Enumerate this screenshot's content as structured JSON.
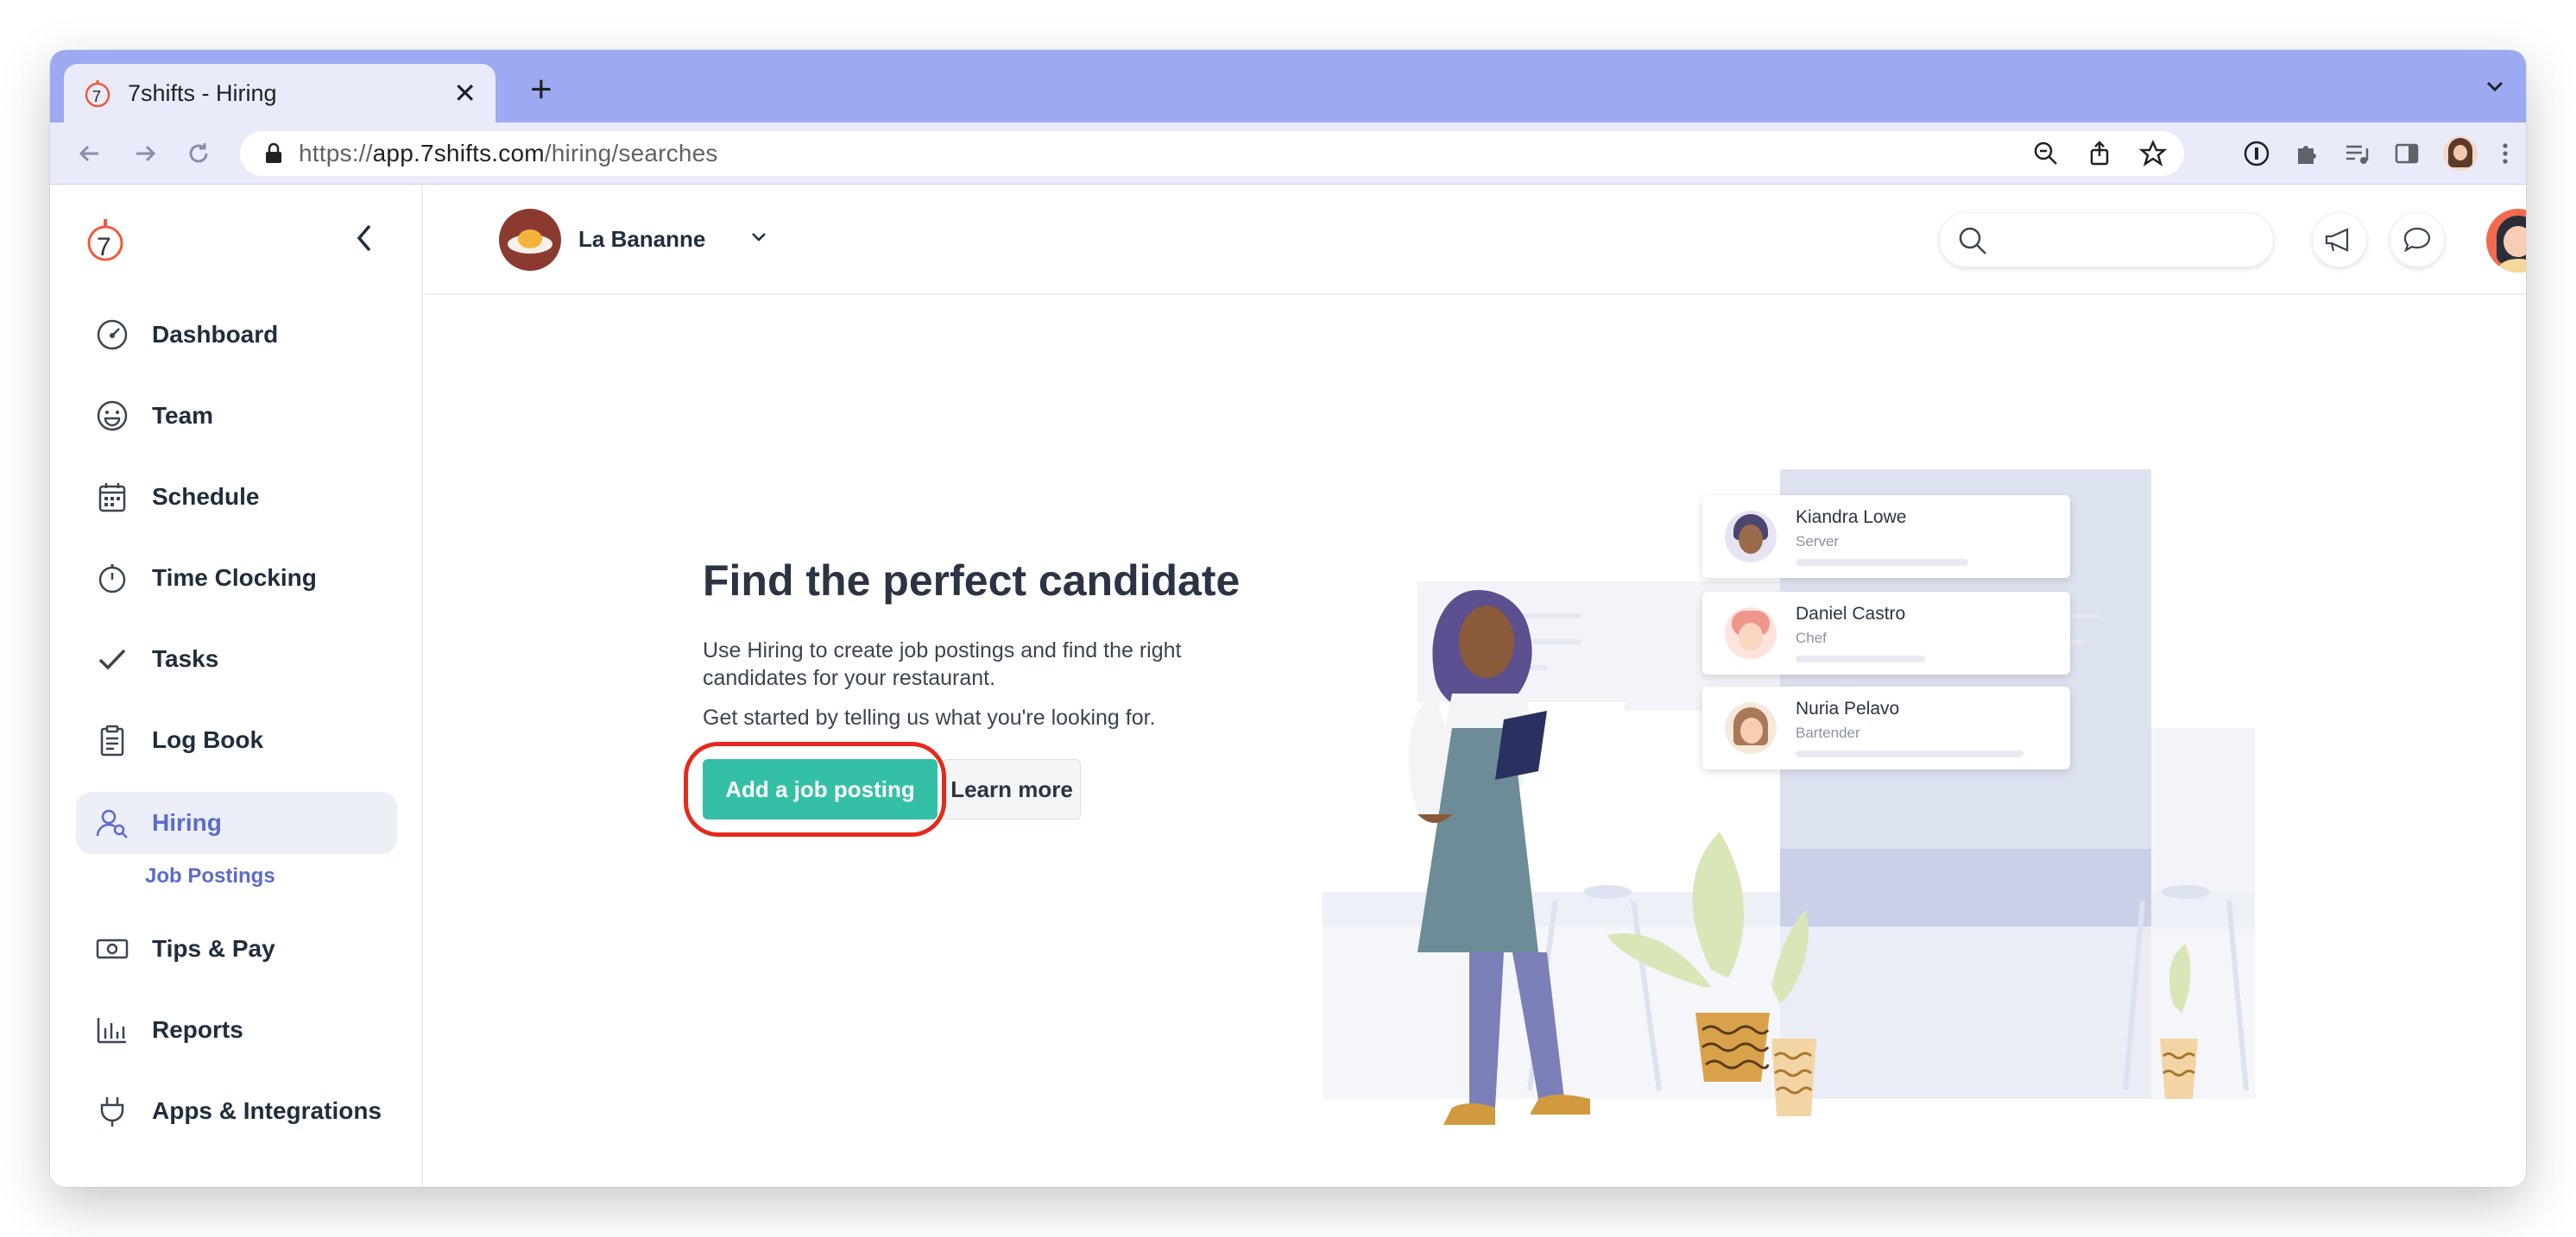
{
  "browser": {
    "tab_title": "7shifts - Hiring",
    "url_prefix": "https://",
    "url_host": "app.7shifts.com",
    "url_path": "/hiring/searches"
  },
  "sidebar": {
    "items": [
      {
        "label": "Dashboard",
        "icon": "dashboard-gauge-icon"
      },
      {
        "label": "Team",
        "icon": "smiley-icon"
      },
      {
        "label": "Schedule",
        "icon": "calendar-icon"
      },
      {
        "label": "Time Clocking",
        "icon": "stopwatch-icon"
      },
      {
        "label": "Tasks",
        "icon": "checkmark-icon"
      },
      {
        "label": "Log Book",
        "icon": "clipboard-icon"
      },
      {
        "label": "Hiring",
        "icon": "person-search-icon",
        "active": true
      },
      {
        "label": "Tips & Pay",
        "icon": "cash-icon"
      },
      {
        "label": "Reports",
        "icon": "bar-chart-icon"
      },
      {
        "label": "Apps & Integrations",
        "icon": "plug-icon"
      }
    ],
    "sub_item": "Job Postings"
  },
  "header": {
    "location_name": "La Bananne"
  },
  "main": {
    "title": "Find the perfect candidate",
    "description": "Use Hiring to create job postings and find the right candidates for your restaurant.",
    "cta_text": "Get started by telling us what you're looking for.",
    "primary_button": "Add a job posting",
    "secondary_button": "Learn more"
  },
  "candidates": [
    {
      "name": "Kiandra Lowe",
      "role": "Server"
    },
    {
      "name": "Daniel Castro",
      "role": "Chef"
    },
    {
      "name": "Nuria Pelavo",
      "role": "Bartender"
    }
  ],
  "colors": {
    "accent": "#5b6bc9",
    "primary_button": "#34c0a6",
    "highlight_ring": "#e52a1b",
    "tab_strip": "#9da9f0"
  }
}
